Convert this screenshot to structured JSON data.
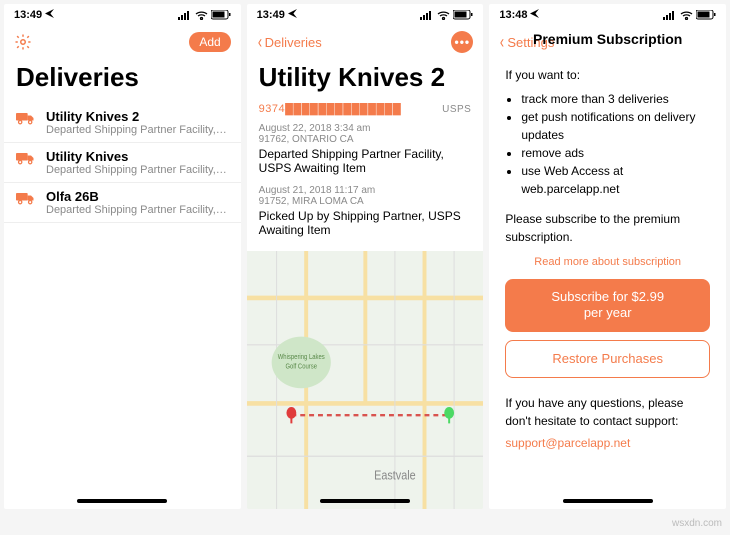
{
  "accent": "#f47b4b",
  "screen1": {
    "time": "13:49",
    "addLabel": "Add",
    "title": "Deliveries",
    "items": [
      {
        "name": "Utility Knives 2",
        "sub": "Departed Shipping Partner Facility, USPS Aw..."
      },
      {
        "name": "Utility Knives",
        "sub": "Departed Shipping Partner Facility, USPS Aw..."
      },
      {
        "name": "Olfa 26B",
        "sub": "Departed Shipping Partner Facility, USPS Aw..."
      }
    ]
  },
  "screen2": {
    "time": "13:49",
    "back": "Deliveries",
    "title": "Utility Knives 2",
    "tracking": "9374██████████████",
    "carrier": "USPS",
    "events": [
      {
        "ts": "August 22, 2018 3:34 am",
        "loc": "91762, ONTARIO CA",
        "desc": "Departed Shipping Partner Facility, USPS Awaiting Item"
      },
      {
        "ts": "August 21, 2018 11:17 am",
        "loc": "91752, MIRA LOMA CA",
        "desc": "Picked Up by Shipping Partner, USPS Awaiting Item"
      }
    ],
    "map": {
      "labelGolf": "Whispering Lakes Golf Course",
      "labelCity": "Eastvale"
    }
  },
  "screen3": {
    "time": "13:48",
    "back": "Settings",
    "title": "Premium Subscription",
    "intro": "If you want to:",
    "bullets": [
      "track more than 3 deliveries",
      "get push notifications on delivery updates",
      "remove ads",
      "use Web Access at web.parcelapp.net"
    ],
    "please": "Please subscribe to the premium subscription.",
    "readMore": "Read more about subscription",
    "subscribeLine1": "Subscribe for $2.99",
    "subscribeLine2": "per year",
    "restore": "Restore Purchases",
    "contactIntro": "If you have any questions, please don't hesitate to contact support:",
    "contactEmail": "support@parcelapp.net"
  },
  "watermark": "wsxdn.com"
}
